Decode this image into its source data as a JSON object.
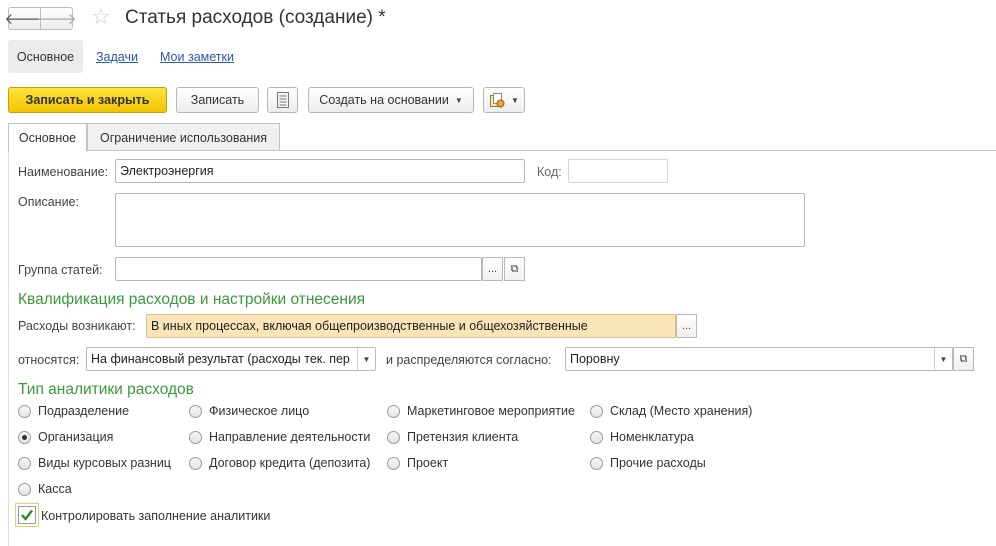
{
  "window": {
    "title": "Статья расходов (создание) *"
  },
  "sections": {
    "main": "Основное",
    "tasks": "Задачи",
    "notes": "Мои заметки"
  },
  "toolbar": {
    "save_close": "Записать и закрыть",
    "save": "Записать",
    "create_based": "Создать на основании"
  },
  "tabs": {
    "main": "Основное",
    "restriction": "Ограничение использования"
  },
  "form": {
    "name_label": "Наименование:",
    "name_value": "Электроэнергия",
    "code_label": "Код:",
    "code_value": "",
    "description_label": "Описание:",
    "description_value": "",
    "group_label": "Группа статей:",
    "group_value": "",
    "qualification_title": "Квалификация расходов и настройки отнесения",
    "expenses_arise_label": "Расходы возникают:",
    "expenses_arise_value": "В иных процессах, включая общепроизводственные и общехозяйственные",
    "relates_label": "относятся:",
    "relates_value": "На финансовый результат (расходы тек. пер",
    "distributed_label": "и распределяются согласно:",
    "distributed_value": "Поровну",
    "analytics_title": "Тип аналитики расходов",
    "control_label": "Контролировать заполнение аналитики"
  },
  "analytics": {
    "selected": "Организация",
    "options": [
      "Подразделение",
      "Физическое лицо",
      "Маркетинговое мероприятие",
      "Склад (Место хранения)",
      "Организация",
      "Направление деятельности",
      "Претензия клиента",
      "Номенклатура",
      "Виды курсовых разниц",
      "Договор кредита (депозита)",
      "Проект",
      "Прочие расходы",
      "Касса"
    ]
  },
  "control_checked": true
}
